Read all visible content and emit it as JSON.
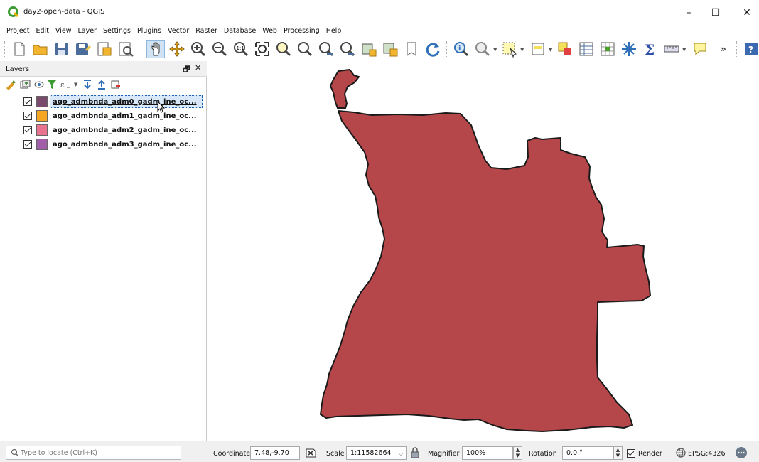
{
  "window": {
    "title": "day2-open-data - QGIS",
    "minimize": "–",
    "maximize": "☐",
    "close": "✕"
  },
  "menubar": [
    "Project",
    "Edit",
    "View",
    "Layer",
    "Settings",
    "Plugins",
    "Vector",
    "Raster",
    "Database",
    "Web",
    "Processing",
    "Help"
  ],
  "layers_panel": {
    "title": "Layers",
    "float_icon": "float-icon",
    "close_icon": "close-icon",
    "layers": [
      {
        "name": "ago_admbnda_adm0_gadm_ine_oc...",
        "checked": true,
        "color": "#7b4b6e",
        "selected": true
      },
      {
        "name": "ago_admbnda_adm1_gadm_ine_oc...",
        "checked": true,
        "color": "#f5a623"
      },
      {
        "name": "ago_admbnda_adm2_gadm_ine_oc...",
        "checked": true,
        "color": "#e8738f"
      },
      {
        "name": "ago_admbnda_adm3_gadm_ine_oc...",
        "checked": true,
        "color": "#a05fa6"
      }
    ]
  },
  "map": {
    "fill_color": "#b5474b",
    "outline_color": "#1a1a1a",
    "background": "#ffffff"
  },
  "statusbar": {
    "locator_placeholder": "Type to locate (Ctrl+K)",
    "coordinate_label": "Coordinate",
    "coordinate_value": "7.48,-9.70",
    "scale_label": "Scale",
    "scale_value": "1:11582664",
    "magnifier_label": "Magnifier",
    "magnifier_value": "100%",
    "rotation_label": "Rotation",
    "rotation_value": "0.0 °",
    "render_label": "Render",
    "render_checked": true,
    "crs_value": "EPSG:4326"
  }
}
